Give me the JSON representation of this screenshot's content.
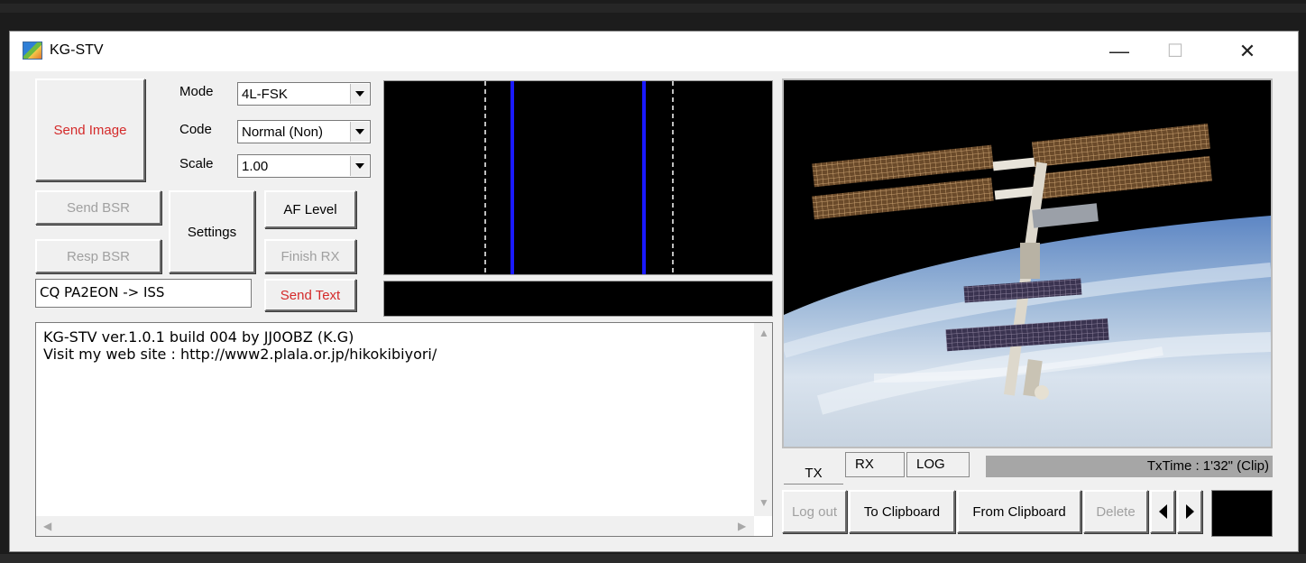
{
  "window": {
    "title": "KG-STV",
    "minimize_glyph": "—",
    "maximize_glyph": "☐",
    "close_glyph": "✕"
  },
  "controls": {
    "send_image": "Send Image",
    "mode_label": "Mode",
    "mode_value": "4L-FSK",
    "code_label": "Code",
    "code_value": "Normal (Non)",
    "scale_label": "Scale",
    "scale_value": "1.00",
    "send_bsr": "Send BSR",
    "resp_bsr": "Resp BSR",
    "settings": "Settings",
    "af_level": "AF Level",
    "finish_rx": "Finish RX",
    "send_text": "Send Text",
    "message_input_value": "CQ PA2EON -> ISS"
  },
  "log": {
    "lines": [
      "KG-STV ver.1.0.1 build 004  by JJ0OBZ (K.G)",
      "Visit my web site : http://www2.plala.or.jp/hikokibiyori/"
    ]
  },
  "image_panel": {
    "tabs": [
      "TX",
      "RX",
      "LOG"
    ],
    "active_tab": "TX",
    "tx_time": "TxTime : 1'32\" (Clip)",
    "image_icon": "iss-space-station-image"
  },
  "bottom_buttons": {
    "log_out": "Log out",
    "to_clipboard": "To Clipboard",
    "from_clipboard": "From Clipboard",
    "delete": "Delete",
    "prev_icon": "triangle-left-icon",
    "next_icon": "triangle-right-icon"
  },
  "colors": {
    "accent_red": "#d42a2a",
    "spectrum_marker": "#1a1aff",
    "panel_black": "#000000"
  }
}
